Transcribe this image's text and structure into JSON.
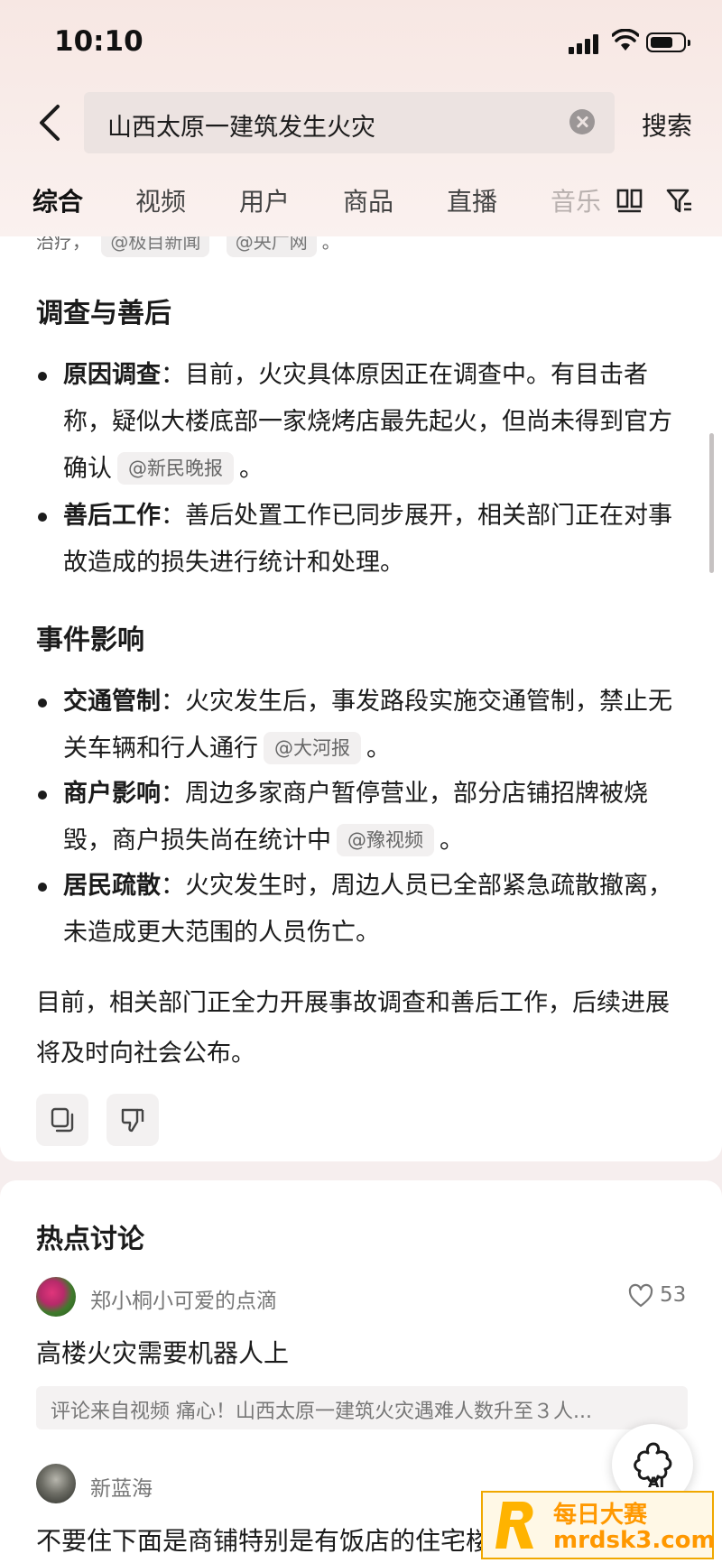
{
  "status_bar": {
    "time": "10:10"
  },
  "search": {
    "query": "山西太原一建筑发生火灾",
    "button": "搜索"
  },
  "tabs": [
    {
      "label": "综合"
    },
    {
      "label": "视频"
    },
    {
      "label": "用户"
    },
    {
      "label": "商品"
    },
    {
      "label": "直播"
    },
    {
      "label": "音乐"
    }
  ],
  "cut_line": {
    "prefix": "治疗",
    "sep": "，",
    "chips": [
      "@极目新闻",
      "@央广网"
    ],
    "end": "。"
  },
  "investigation": {
    "title": "调查与善后",
    "items": [
      {
        "keyword": "原因调查",
        "text": "：目前，火灾具体原因正在调查中。有目击者称，疑似大楼底部一家烧烤店最先起火，但尚未得到官方确认",
        "source": "@新民晚报",
        "end": "。"
      },
      {
        "keyword": "善后工作",
        "text": "：善后处置工作已同步展开，相关部门正在对事故造成的损失进行统计和处理。",
        "source": "",
        "end": ""
      }
    ]
  },
  "impact": {
    "title": "事件影响",
    "items": [
      {
        "keyword": "交通管制",
        "text": "：火灾发生后，事发路段实施交通管制，禁止无关车辆和行人通行",
        "source": "@大河报",
        "end": "。"
      },
      {
        "keyword": "商户影响",
        "text": "：周边多家商户暂停营业，部分店铺招牌被烧毁，商户损失尚在统计中",
        "source": "@豫视频",
        "end": "。"
      },
      {
        "keyword": "居民疏散",
        "text": "：火灾发生时，周边人员已全部紧急疏散撤离，未造成更大范围的人员伤亡。",
        "source": "",
        "end": ""
      }
    ]
  },
  "summary": "目前，相关部门正全力开展事故调查和善后工作，后续进展将及时向社会公布。",
  "hot": {
    "title": "热点讨论",
    "comments": [
      {
        "user": "郑小桐小可爱的点滴",
        "likes": "53",
        "text": "高楼火灾需要机器人上",
        "ref": "评论来自视频 痛心！山西太原一建筑火灾遇难人数升至３人..."
      },
      {
        "user": "新蓝海",
        "text": "不要住下面是商铺特别是有饭店的住宅楼的"
      }
    ]
  },
  "watermark": {
    "line1": "每日大赛",
    "line2": "mrdsk3.com"
  },
  "icons": {
    "back": "back-arrow-icon",
    "clear": "clear-icon",
    "layout": "layout-icon",
    "filter": "filter-icon",
    "copy": "copy-icon",
    "dislike": "thumbs-down-icon",
    "like": "heart-icon",
    "ai": "ai-assistant-icon"
  }
}
